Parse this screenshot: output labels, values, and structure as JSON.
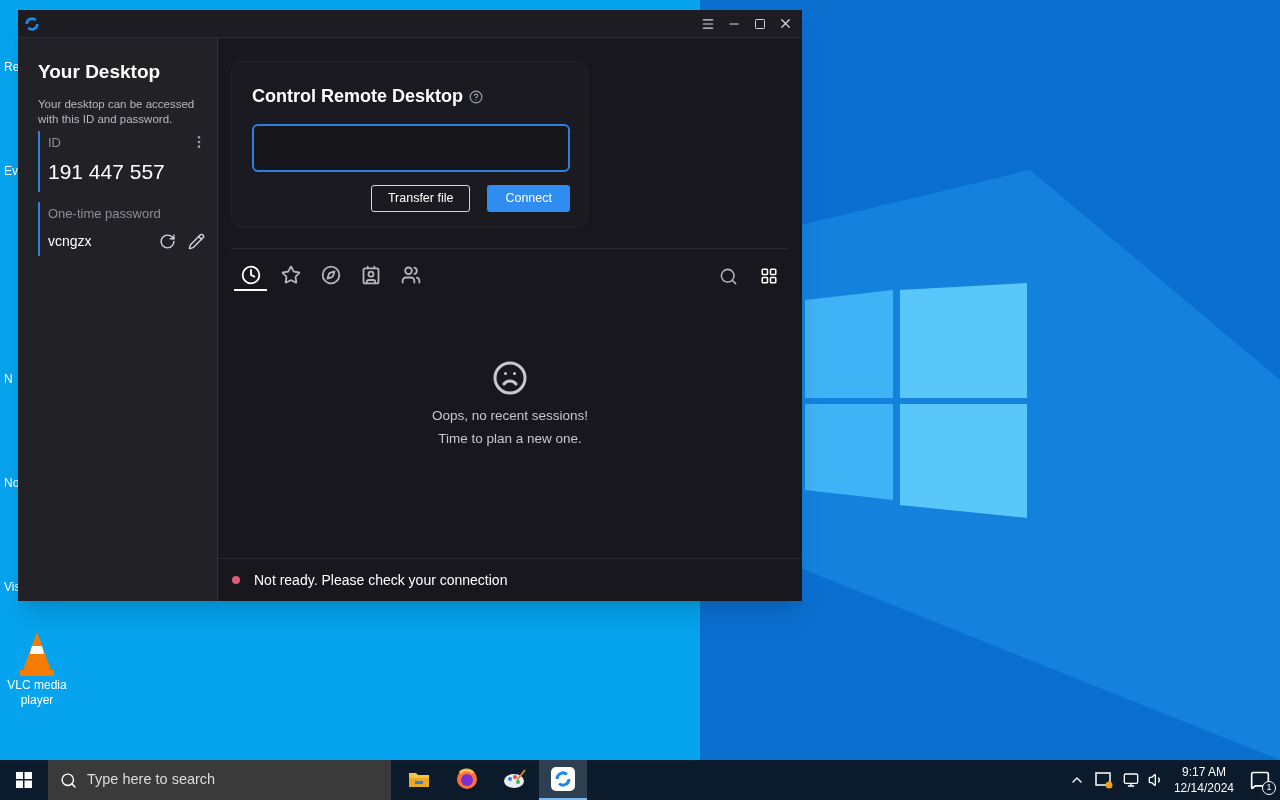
{
  "desktop": {
    "icon_fragments": [
      "Re",
      "Ev",
      "N",
      "No",
      "Vis"
    ],
    "icons": [
      {
        "label": "VLC media player"
      }
    ]
  },
  "window": {
    "sidebar": {
      "title": "Your Desktop",
      "description": "Your desktop can be accessed with this ID and password.",
      "id_label": "ID",
      "id_value": "191 447 557",
      "password_label": "One-time password",
      "password_value": "vcngzx"
    },
    "control": {
      "title": "Control Remote Desktop",
      "buttons": [
        {
          "kind": "outline",
          "label": "Transfer file"
        },
        {
          "kind": "primary",
          "label": "Connect"
        }
      ]
    },
    "tabs": [
      {
        "kind": "clock",
        "selected": true
      },
      {
        "kind": "star",
        "selected": false
      },
      {
        "kind": "compass",
        "selected": false
      },
      {
        "kind": "contact",
        "selected": false
      },
      {
        "kind": "people",
        "selected": false
      }
    ],
    "empty_state": {
      "line_1": "Oops, no recent sessions!",
      "line_2": "Time to plan a new one."
    },
    "status_bar": {
      "text": "Not ready. Please check your connection",
      "color": "#e05a7a"
    }
  },
  "taskbar": {
    "search_placeholder": "Type here to search",
    "apps": [
      {
        "kind": "folder",
        "selected": false
      },
      {
        "kind": "firefox",
        "selected": false
      },
      {
        "kind": "paint",
        "selected": false
      },
      {
        "kind": "remote",
        "selected": true
      }
    ],
    "time": "9:17 AM",
    "date": "12/14/2024",
    "notifications": "1"
  }
}
